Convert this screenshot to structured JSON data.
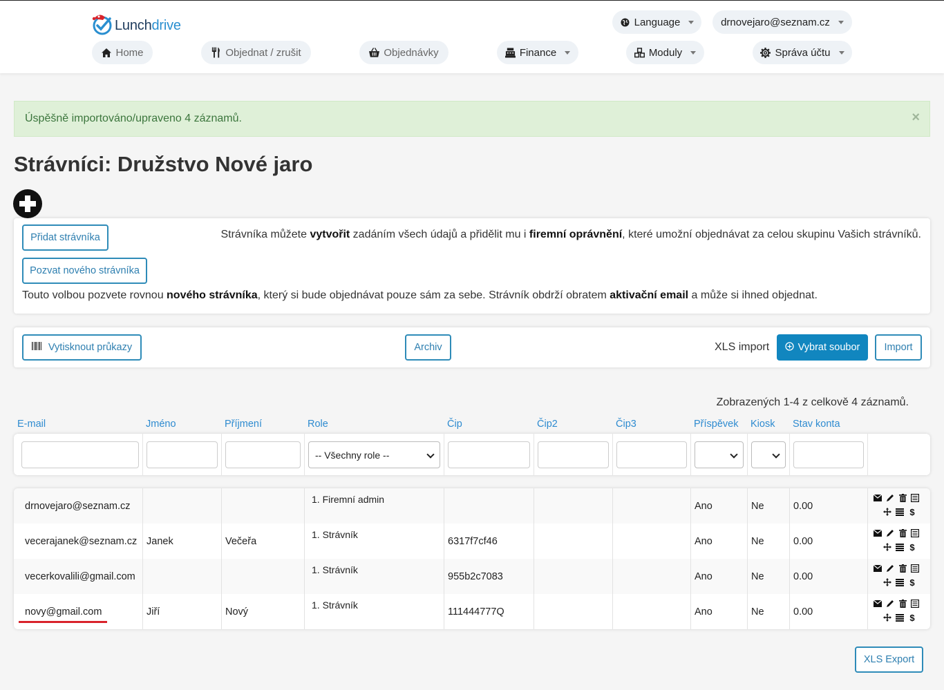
{
  "brand": {
    "name_part1": "Lunch",
    "name_part2": "drive"
  },
  "header": {
    "language_label": "Language",
    "user_email": "drnovejaro@seznam.cz",
    "nav": {
      "home": "Home",
      "order": "Objednat / zrušit",
      "orders": "Objednávky",
      "finance": "Finance",
      "modules": "Moduly",
      "account": "Správa účtu"
    }
  },
  "alert": {
    "message": "Úspěšně importováno/upraveno 4 záznamů.",
    "close": "×"
  },
  "page_title": "Strávníci: Družstvo Nové jaro",
  "panel_add": {
    "add_button": "Přidat strávníka",
    "invite_button": "Pozvat nového strávníka",
    "add_text_1": "Strávníka můžete ",
    "add_text_b1": "vytvořit",
    "add_text_2": " zadáním všech údajů a přidělit mu i ",
    "add_text_b2": "firemní oprávnění",
    "add_text_3": ", které umožní objednávat za celou skupinu Vašich strávníků.",
    "invite_text_1": "Touto volbou pozvete rovnou ",
    "invite_text_b1": "nového strávníka",
    "invite_text_2": ", který si bude objednávat pouze sám za sebe. Strávník obdrží obratem ",
    "invite_text_b2": "aktivační email",
    "invite_text_3": " a může si ihned objednat."
  },
  "toolbar": {
    "print_cards": "Vytisknout průkazy",
    "archive": "Archiv",
    "xls_import_label": "XLS import",
    "choose_file": "Vybrat soubor",
    "import": "Import"
  },
  "summary": "Zobrazených 1-4 z celkově 4 záznamů.",
  "columns": {
    "email": "E-mail",
    "first_name": "Jméno",
    "last_name": "Příjmení",
    "role": "Role",
    "chip": "Čip",
    "chip2": "Čip2",
    "chip3": "Čip3",
    "contribution": "Příspěvek",
    "kiosk": "Kiosk",
    "balance": "Stav konta"
  },
  "filters": {
    "role_selected": "-- Všechny role --",
    "contribution_selected": "",
    "kiosk_selected": ""
  },
  "rows": [
    {
      "email": "drnovejaro@seznam.cz",
      "first_name": "",
      "last_name": "",
      "role": "1. Firemní admin",
      "chip": "",
      "chip2": "",
      "chip3": "",
      "contribution": "Ano",
      "kiosk": "Ne",
      "balance": "0.00"
    },
    {
      "email": "vecerajanek@seznam.cz",
      "first_name": "Janek",
      "last_name": "Večeřa",
      "role": "1. Strávník",
      "chip": "6317f7cf46",
      "chip2": "",
      "chip3": "",
      "contribution": "Ano",
      "kiosk": "Ne",
      "balance": "0.00"
    },
    {
      "email": "vecerkovalili@gmail.com",
      "first_name": "",
      "last_name": "",
      "role": "1. Strávník",
      "chip": "955b2c7083",
      "chip2": "",
      "chip3": "",
      "contribution": "Ano",
      "kiosk": "Ne",
      "balance": "0.00"
    },
    {
      "email": "novy@gmail.com",
      "first_name": "Jiří",
      "last_name": "Nový",
      "role": "1. Strávník",
      "chip": "111444777Q",
      "chip2": "",
      "chip3": "",
      "contribution": "Ano",
      "kiosk": "Ne",
      "balance": "0.00"
    }
  ],
  "row_action_dollar": "$",
  "xls_export": "XLS Export",
  "colors": {
    "accent": "#1186bf",
    "link": "#2e8bd0",
    "alert_bg": "#dff0d8",
    "alert_text": "#3c763d",
    "highlight_underline": "#d9232b"
  }
}
